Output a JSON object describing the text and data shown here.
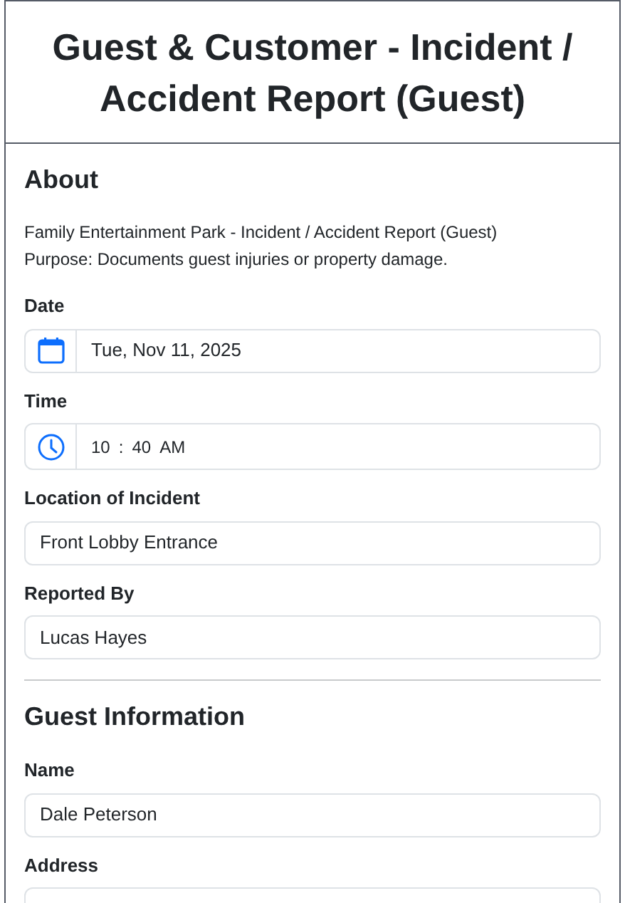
{
  "title": "Guest & Customer - Incident / Accident Report (Guest)",
  "sections": [
    {
      "heading": "About",
      "description": [
        "Family Entertainment Park - Incident / Accident Report (Guest)",
        "Purpose: Documents guest injuries or property damage."
      ],
      "fields": [
        {
          "kind": "date",
          "label": "Date",
          "value": "Tue, Nov 11, 2025"
        },
        {
          "kind": "time",
          "label": "Time",
          "hour": "10",
          "separator": ":",
          "minute": "40",
          "period": "AM"
        },
        {
          "kind": "text",
          "label": "Location of Incident",
          "value": "Front Lobby Entrance"
        },
        {
          "kind": "text",
          "label": "Reported By",
          "value": "Lucas Hayes"
        }
      ]
    },
    {
      "heading": "Guest Information",
      "fields": [
        {
          "kind": "text",
          "label": "Name",
          "value": "Dale Peterson"
        },
        {
          "kind": "text",
          "label": "Address"
        }
      ]
    }
  ]
}
